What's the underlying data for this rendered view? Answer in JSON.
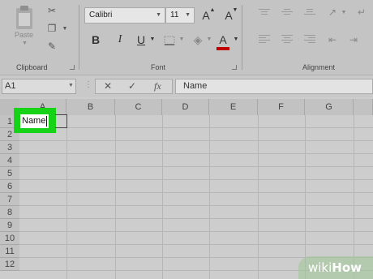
{
  "ribbon": {
    "clipboard": {
      "paste_label": "Paste",
      "group_label": "Clipboard"
    },
    "font": {
      "font_name": "Calibri",
      "font_size": "11",
      "grow_label": "A",
      "shrink_label": "A",
      "bold_label": "B",
      "italic_label": "I",
      "underline_label": "U",
      "font_color_label": "A",
      "group_label": "Font",
      "font_color_hex": "#c00000"
    },
    "alignment": {
      "group_label": "Alignment"
    }
  },
  "formula_bar": {
    "name_box": "A1",
    "cancel_symbol": "✕",
    "enter_symbol": "✓",
    "fx_label": "fx",
    "formula_value": "Name"
  },
  "grid": {
    "columns": [
      "A",
      "B",
      "C",
      "D",
      "E",
      "F",
      "G"
    ],
    "rows": [
      "1",
      "2",
      "3",
      "4",
      "5",
      "6",
      "7",
      "8",
      "9",
      "10",
      "11",
      "12"
    ],
    "cell_a1": "Name",
    "highlight_color": "#17d318"
  },
  "watermark": {
    "prefix": "wiki",
    "suffix": "How"
  }
}
